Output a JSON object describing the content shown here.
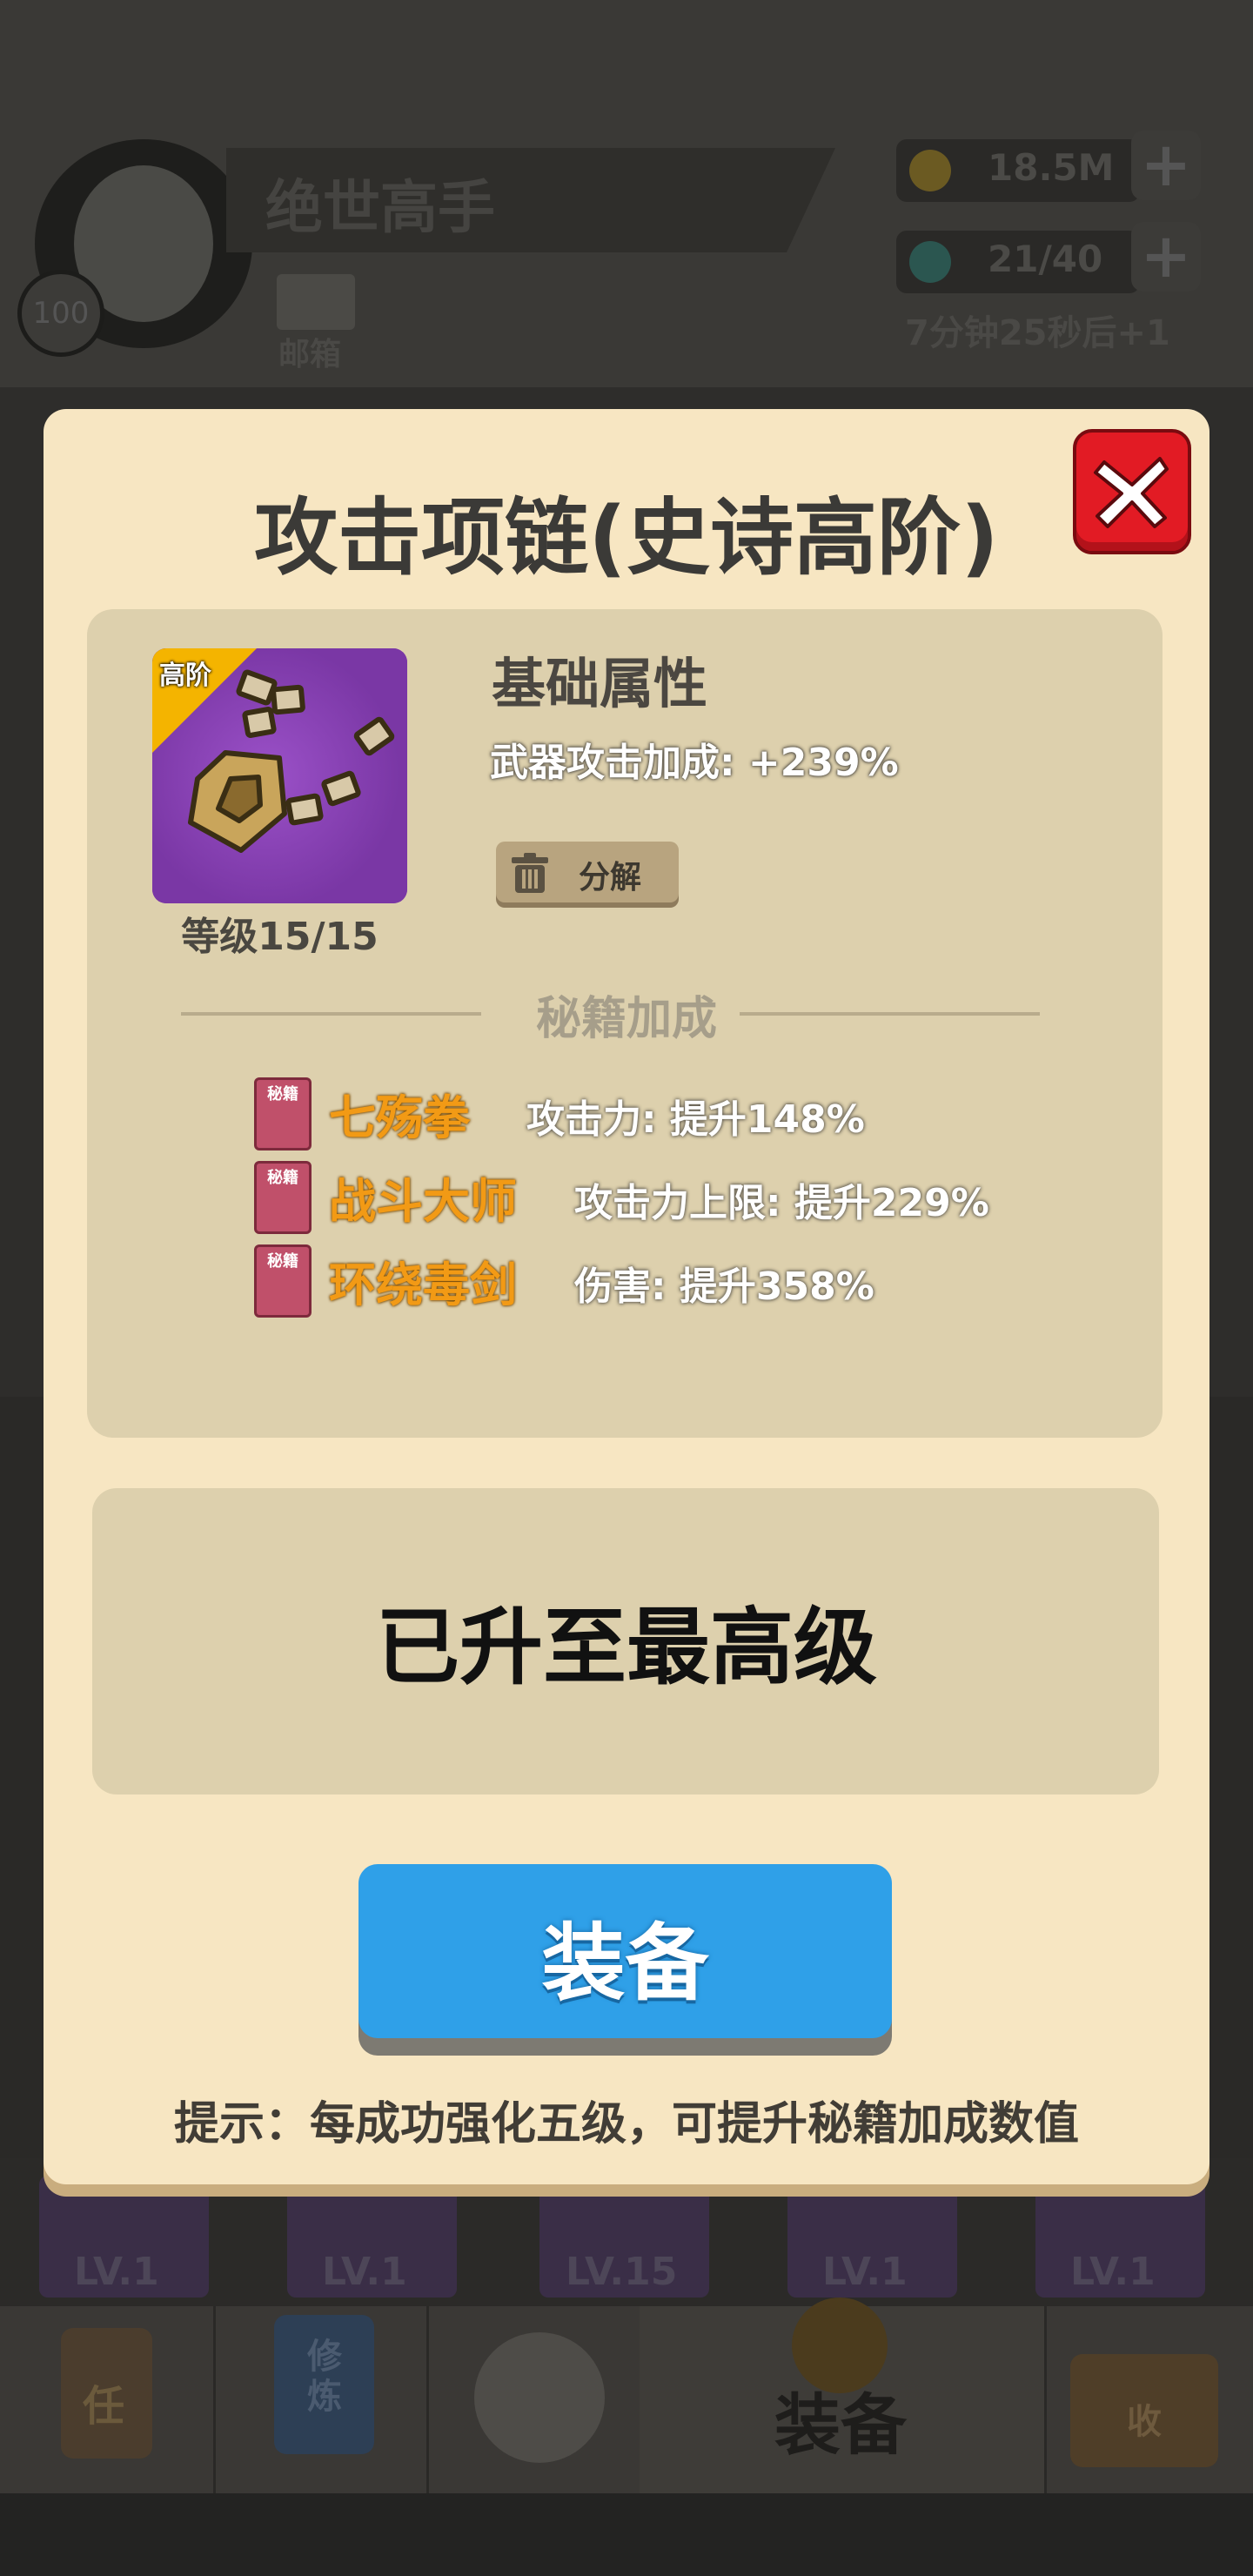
{
  "header": {
    "player_name": "绝世高手",
    "player_level": "100",
    "mail_label": "邮箱",
    "gold": "18.5M",
    "energy": "21/40",
    "energy_timer": "7分钟25秒后+1"
  },
  "bottom_items": [
    {
      "level": "LV.1"
    },
    {
      "level": "LV.1"
    },
    {
      "level": "LV.15"
    },
    {
      "level": "LV.1"
    },
    {
      "level": "LV.1"
    }
  ],
  "nav": {
    "tabs": [
      {
        "label": "任",
        "icon": "task-scroll-icon"
      },
      {
        "label": "修炼",
        "icon": "training-book-icon"
      },
      {
        "label": "",
        "icon": "crossed-swords-icon"
      },
      {
        "label": "装备",
        "icon": "equipment-icon"
      },
      {
        "label": "收",
        "icon": "collection-chest-icon"
      }
    ]
  },
  "modal": {
    "title": "攻击项链(史诗高阶)",
    "item": {
      "rank_badge": "高阶",
      "level": "等级15/15",
      "icon": "necklace-icon",
      "frame_color": "#7a37a5"
    },
    "base_section_title": "基础属性",
    "base_stat": "武器攻击加成: +239%",
    "decompose_label": "分解",
    "skill_bonus_title": "秘籍加成",
    "skill_book_label": "秘籍",
    "skills": [
      {
        "name": "七殇拳",
        "effect": "攻击力: 提升148%"
      },
      {
        "name": "战斗大师",
        "effect": "攻击力上限: 提升229%"
      },
      {
        "name": "环绕毒剑",
        "effect": "伤害: 提升358%"
      }
    ],
    "max_level_text": "已升至最高级",
    "equip_label": "装备",
    "tip": "提示：每成功强化五级，可提升秘籍加成数值"
  },
  "colors": {
    "modal_bg": "#f7e6c2",
    "panel_bg": "#ddd0ad",
    "equip_button": "#2fa0e8",
    "close_button": "#e21b24",
    "skill_name": "#f29a15",
    "rank_badge": "#f4b400"
  }
}
